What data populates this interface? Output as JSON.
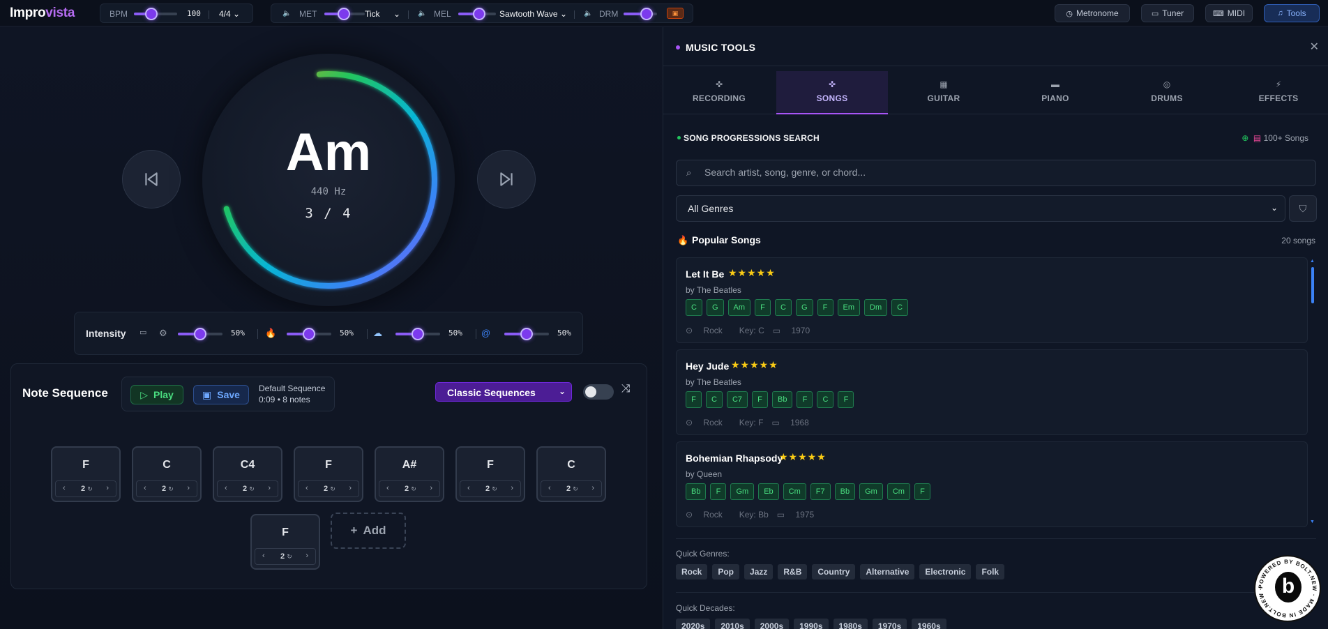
{
  "app": {
    "logo_part1": "Impro",
    "logo_part2": "vista"
  },
  "topbar": {
    "bpm_label": "BPM",
    "bpm_value": "100",
    "time_sig": "4/4",
    "met_label": "MET",
    "met_sound": "Tick",
    "mel_label": "MEL",
    "mel_sound": "Sawtooth Wave",
    "drm_label": "DRM",
    "buttons": {
      "metronome": "Metronome",
      "tuner": "Tuner",
      "midi": "MIDI",
      "tools": "Tools"
    }
  },
  "player": {
    "chord": "Am",
    "frequency": "440 Hz",
    "beat": "3 / 4",
    "progress": 0.72
  },
  "intensity": {
    "title": "Intensity",
    "values": [
      "50%",
      "50%",
      "50%",
      "50%"
    ]
  },
  "sequence": {
    "title": "Note Sequence",
    "play_label": "Play",
    "save_label": "Save",
    "name": "Default Sequence",
    "meta": "0:09 • 8 notes",
    "preset": "Classic Sequences",
    "add_label": "Add",
    "notes": [
      {
        "name": "F",
        "dur": "2"
      },
      {
        "name": "C",
        "dur": "2"
      },
      {
        "name": "C4",
        "dur": "2"
      },
      {
        "name": "F",
        "dur": "2"
      },
      {
        "name": "A#",
        "dur": "2"
      },
      {
        "name": "F",
        "dur": "2"
      },
      {
        "name": "C",
        "dur": "2"
      },
      {
        "name": "F",
        "dur": "2"
      }
    ]
  },
  "panel": {
    "title": "MUSIC TOOLS",
    "tabs": [
      "RECORDING",
      "SONGS",
      "GUITAR",
      "PIANO",
      "DRUMS",
      "EFFECTS"
    ],
    "active_tab": "SONGS",
    "section_title": "SONG PROGRESSIONS SEARCH",
    "songs_count": "100+ Songs",
    "search_placeholder": "Search artist, song, genre, or chord...",
    "genre_select": "All Genres",
    "popular_title": "Popular Songs",
    "popular_count": "20 songs",
    "songs": [
      {
        "title": "Let It Be",
        "stars": "★★★★★",
        "artist": "by The Beatles",
        "chords": [
          "C",
          "G",
          "Am",
          "F",
          "C",
          "G",
          "F",
          "Em",
          "Dm",
          "C"
        ],
        "genre": "Rock",
        "key": "Key: C",
        "year": "1970"
      },
      {
        "title": "Hey Jude",
        "stars": "★★★★★",
        "artist": "by The Beatles",
        "chords": [
          "F",
          "C",
          "C7",
          "F",
          "Bb",
          "F",
          "C",
          "F"
        ],
        "genre": "Rock",
        "key": "Key: F",
        "year": "1968"
      },
      {
        "title": "Bohemian Rhapsody",
        "stars": "★★★★★",
        "artist": "by Queen",
        "chords": [
          "Bb",
          "F",
          "Gm",
          "Eb",
          "Cm",
          "F7",
          "Bb",
          "Gm",
          "Cm",
          "F"
        ],
        "genre": "Rock",
        "key": "Key: Bb",
        "year": "1975"
      }
    ],
    "quick_genres_label": "Quick Genres:",
    "quick_genres": [
      "Rock",
      "Pop",
      "Jazz",
      "R&B",
      "Country",
      "Alternative",
      "Electronic",
      "Folk"
    ],
    "quick_decades_label": "Quick Decades:",
    "quick_decades": [
      "2020s",
      "2010s",
      "2000s",
      "1990s",
      "1980s",
      "1970s",
      "1960s"
    ]
  }
}
